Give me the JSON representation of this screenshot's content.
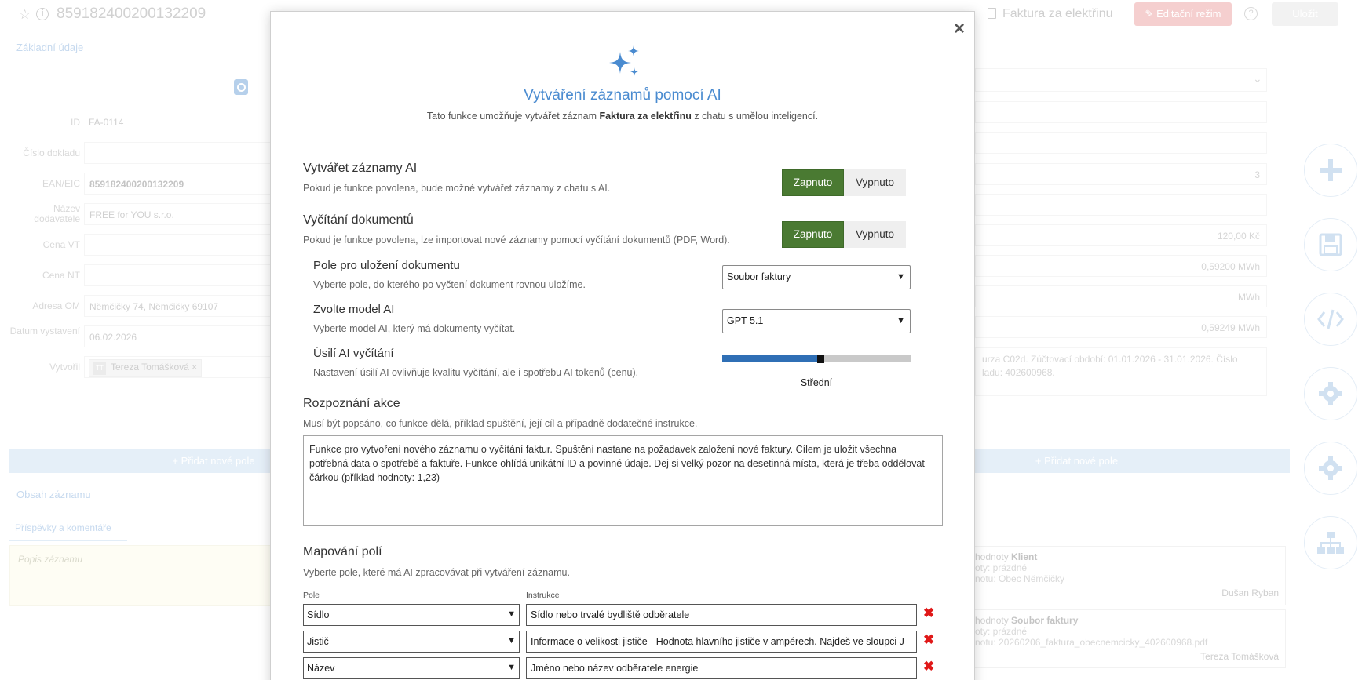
{
  "app": {
    "record_title": "859182400200132209",
    "record_type": "Faktura za elektřinu",
    "edit_mode_label": "Editační režim",
    "save_label": "Uložit",
    "help_symbol": "?"
  },
  "left_form": {
    "section_title": "Základní údaje",
    "fields": [
      {
        "label": "ID",
        "value": "FA-0114"
      },
      {
        "label": "Číslo dokladu",
        "value": ""
      },
      {
        "label": "EAN/EIC",
        "value": "859182400200132209"
      },
      {
        "label": "Název dodavatele",
        "value": "FREE for YOU s.r.o."
      },
      {
        "label": "Cena VT",
        "value": ""
      },
      {
        "label": "Cena NT",
        "value": ""
      },
      {
        "label": "Adresa OM",
        "value": "Němčičky 74, Němčičky 69107"
      },
      {
        "label": "Datum vystavení",
        "value": "06.02.2026"
      },
      {
        "label": "Vytvořil",
        "value": "Tereza Tomášková",
        "avatar": "TT",
        "remove": "×"
      }
    ],
    "add_field_label": "+ Přidat nové pole",
    "content_section": "Obsah záznamu",
    "comments_tab": "Příspěvky a komentáře",
    "description_placeholder": "Popis záznamu"
  },
  "right_form": {
    "values": [
      "3",
      "120,00 Kč",
      "0,59200 MWh",
      "MWh",
      "0,59249 MWh"
    ],
    "note": "urza C02d. Zúčtovací období: 01.01.2026 - 31.01.2026. Číslo\nladu: 402600968.",
    "add_field_label": "+ Přidat nové pole",
    "history": [
      {
        "prefix": "hodnoty",
        "field": "Klient",
        "l1": "oty: prázdné",
        "l2": "notu: Obec Němčičky",
        "by": "Dušan Ryban"
      },
      {
        "prefix": "hodnoty",
        "field": "Soubor faktury",
        "l1": "oty: prázdné",
        "l2": "notu: 20260206_faktura_obecnemcicky_402600968.pdf",
        "by": "Tereza Tomášková"
      }
    ]
  },
  "modal": {
    "close_symbol": "×",
    "title": "Vytváření záznamů pomocí AI",
    "subtitle_prefix": "Tato funkce umožňuje vytvářet záznam ",
    "subtitle_bold": "Faktura za elektřinu",
    "subtitle_suffix": " z chatu s umělou inteligencí.",
    "create_ai": {
      "title": "Vytvářet záznamy AI",
      "desc": "Pokud je funkce povolena, bude možné vytvářet záznamy z chatu s AI.",
      "on": "Zapnuto",
      "off": "Vypnuto"
    },
    "doc_read": {
      "title": "Vyčítání dokumentů",
      "desc": "Pokud je funkce povolena, lze importovat nové záznamy pomocí vyčítání dokumentů (PDF, Word).",
      "on": "Zapnuto",
      "off": "Vypnuto"
    },
    "doc_field": {
      "title": "Pole pro uložení dokumentu",
      "desc": "Vyberte pole, do kterého po vyčtení dokument rovnou uložíme.",
      "value": "Soubor faktury"
    },
    "model": {
      "title": "Zvolte model AI",
      "desc": "Vyberte model AI, který má dokumenty vyčítat.",
      "value": "GPT 5.1"
    },
    "effort": {
      "title": "Úsilí AI vyčítání",
      "desc": "Nastavení úsilí AI ovlivňuje kvalitu vyčítání, ale i spotřebu AI tokenů (cenu).",
      "level_label": "Střední",
      "level_fraction": 0.52
    },
    "action": {
      "title": "Rozpoznání akce",
      "desc": "Musí být popsáno, co funkce dělá, příklad spuštění, její cíl a případně dodatečné instrukce.",
      "text": "Funkce pro vytvoření nového záznamu o vyčítání faktur. Spuštění nastane na požadavek založení nové faktury. Cílem je uložit všechna potřebná data o spotřebě a faktuře. Funkce ohlídá unikátní ID a povinné údaje. Dej si velký pozor na desetinná místa, která je třeba oddělovat čárkou (příklad hodnoty: 1,23)"
    },
    "mapping": {
      "title": "Mapování polí",
      "desc": "Vyberte pole, které má AI zpracovávat při vytváření záznamu.",
      "col_field": "Pole",
      "col_instr": "Instrukce",
      "rows": [
        {
          "field": "Sídlo",
          "instruction": "Sídlo nebo trvalé bydliště odběratele"
        },
        {
          "field": "Jistič",
          "instruction": "Informace o velikosti jističe - Hodnota hlavního jističe v ampérech. Najdeš ve sloupci J"
        },
        {
          "field": "Název",
          "instruction": "Jméno nebo název odběratele energie"
        }
      ]
    }
  },
  "colors": {
    "accent": "#4a8bd0",
    "on_green": "#4a7a32",
    "delete_red": "#e01818",
    "slider_blue": "#2f6fb5"
  }
}
